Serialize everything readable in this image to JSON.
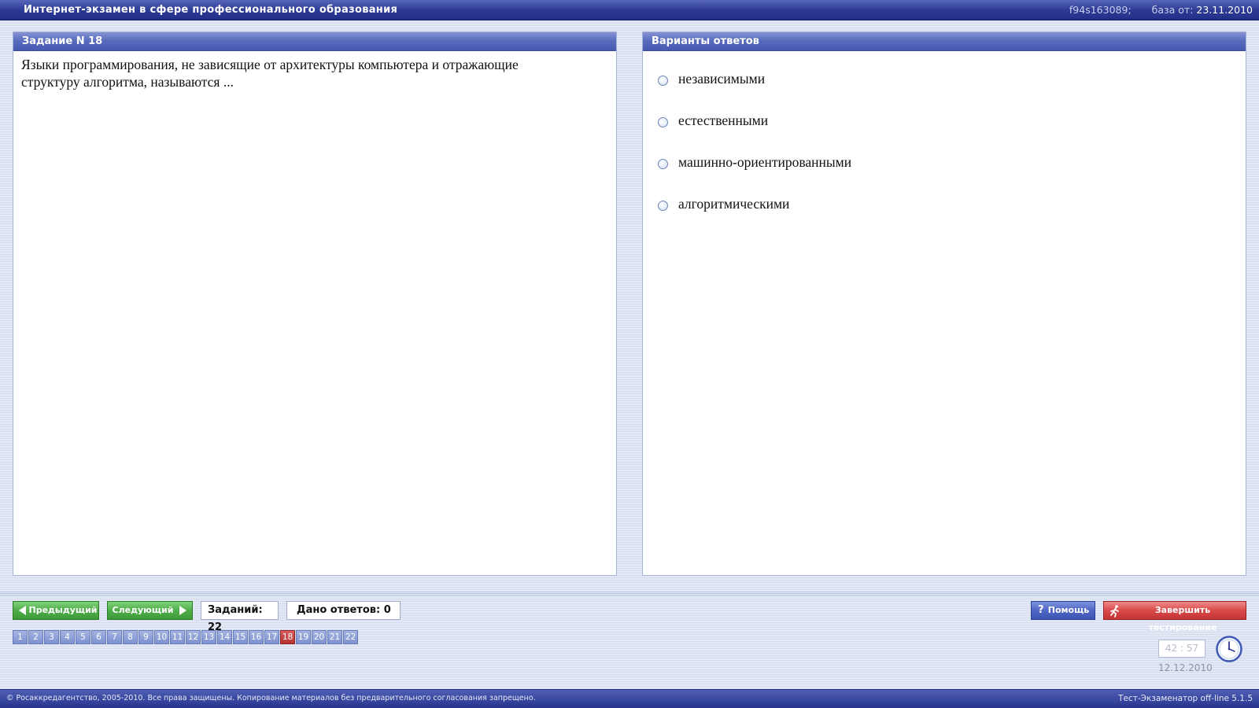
{
  "header": {
    "title": "Интернет-экзамен в сфере профессионального образования",
    "session_id": "f94s163089;",
    "base_label": "база от:",
    "base_date": "23.11.2010"
  },
  "question_panel": {
    "title": "Задание N 18",
    "text": "Языки программирования, не зависящие от архитектуры компьютера и отражающие\nструктуру алгоритма, называются ..."
  },
  "answers_panel": {
    "title": "Варианты ответов",
    "options": [
      {
        "label": "независимыми"
      },
      {
        "label": "естественными"
      },
      {
        "label": "машинно-ориентированными"
      },
      {
        "label": "алгоритмическими"
      }
    ]
  },
  "toolbar": {
    "prev_label": "Предыдущий",
    "next_label": "Следующий",
    "tasks_count": "Заданий: 22",
    "answered_count": "Дано ответов: 0",
    "help_label": "Помощь",
    "finish_label": "Завершить тестирование"
  },
  "pager": {
    "current": 18,
    "pages": [
      "1",
      "2",
      "3",
      "4",
      "5",
      "6",
      "7",
      "8",
      "9",
      "10",
      "11",
      "12",
      "13",
      "14",
      "15",
      "16",
      "17",
      "18",
      "19",
      "20",
      "21",
      "22"
    ]
  },
  "timer": {
    "value": "42 : 57",
    "date": "12.12.2010"
  },
  "footer": {
    "copyright": "© Росаккредагентство, 2005-2010. Все права защищены. Копирование материалов без предварительного согласования запрещено.",
    "version": "Тест-Экзаменатор off-line 5.1.5"
  },
  "icons": {
    "radio": "radio-icon",
    "arrow_left": "arrow-left-icon",
    "arrow_right": "arrow-right-icon",
    "help": "question-mark-icon",
    "finish": "running-man-icon",
    "clock": "clock-icon"
  },
  "colors": {
    "title_bar": "#2c3a94",
    "panel_header": "#5a6cbd",
    "green_button": "#4fae4a",
    "blue_button": "#4f66c4",
    "red_button": "#d94a4a",
    "current_page": "#b63030"
  }
}
